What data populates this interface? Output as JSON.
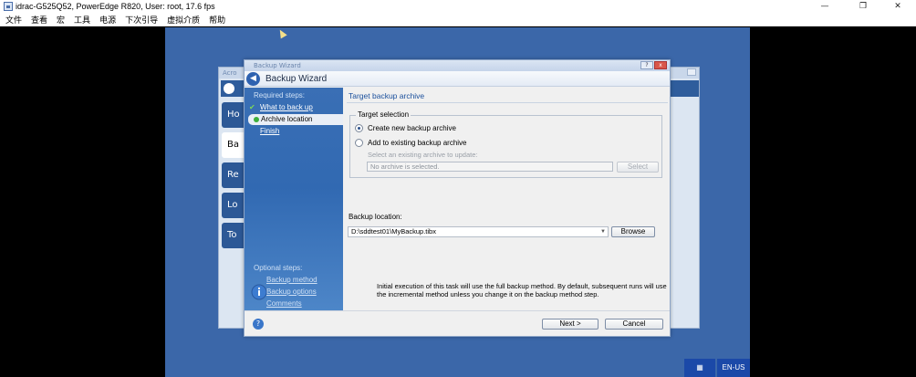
{
  "window": {
    "title": "idrac-G525Q52, PowerEdge R820, User: root, 17.6 fps",
    "minimize": "—",
    "restore": "❐",
    "close": "✕"
  },
  "menu": [
    "文件",
    "查看",
    "宏",
    "工具",
    "电源",
    "下次引导",
    "虚拟介质",
    "帮助"
  ],
  "background_app": {
    "title": "Acro",
    "nav": [
      "Ho",
      "Ba",
      "Re",
      "Lo",
      "To"
    ]
  },
  "wizard": {
    "window_title": "Backup Wizard",
    "title": "Backup Wizard",
    "required_steps_label": "Required steps:",
    "steps": [
      "What to back up",
      "Archive location",
      "Finish"
    ],
    "optional_steps_label": "Optional steps:",
    "optional_steps": [
      "Backup method",
      "Backup options",
      "Comments"
    ],
    "main_title": "Target backup archive",
    "target_selection_label": "Target selection",
    "create_new_label": "Create new backup archive",
    "add_existing_label": "Add to existing backup archive",
    "select_existing_hint": "Select an existing archive to update:",
    "archive_field_value": "No archive is selected.",
    "select_button": "Select",
    "backup_location_label": "Backup location:",
    "backup_location_value": "D:\\sddtest01\\MyBackup.tibx",
    "browse_button": "Browse",
    "info_text": "Initial execution of this task will use the full backup method. By default, subsequent runs will use the incremental method unless you change it on the backup method step.",
    "next_button": "Next >",
    "cancel_button": "Cancel"
  },
  "tray": {
    "language": "EN-US"
  }
}
